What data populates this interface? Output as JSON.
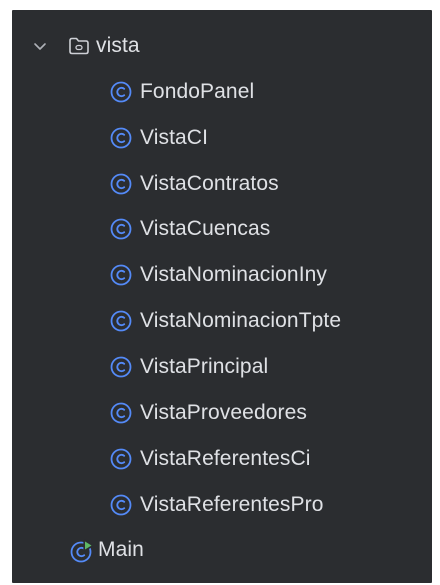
{
  "project_tree": {
    "folder": {
      "label": "vista",
      "icon": "folder-icon",
      "expanded": true
    },
    "classes": [
      {
        "label": "FondoPanel",
        "icon": "class-icon"
      },
      {
        "label": "VistaCI",
        "icon": "class-icon"
      },
      {
        "label": "VistaContratos",
        "icon": "class-icon"
      },
      {
        "label": "VistaCuencas",
        "icon": "class-icon"
      },
      {
        "label": "VistaNominacionIny",
        "icon": "class-icon"
      },
      {
        "label": "VistaNominacionTpte",
        "icon": "class-icon"
      },
      {
        "label": "VistaPrincipal",
        "icon": "class-icon"
      },
      {
        "label": "VistaProveedores",
        "icon": "class-icon"
      },
      {
        "label": "VistaReferentesCi",
        "icon": "class-icon"
      },
      {
        "label": "VistaReferentesPro",
        "icon": "class-icon"
      }
    ],
    "main": {
      "label": "Main",
      "icon": "runnable-class-icon"
    }
  },
  "colors": {
    "panel_background": "#2b2d30",
    "text": "#dfe1e5",
    "class_icon": "#548af7",
    "run_badge": "#5fb865",
    "folder_icon": "#ced0d6"
  }
}
